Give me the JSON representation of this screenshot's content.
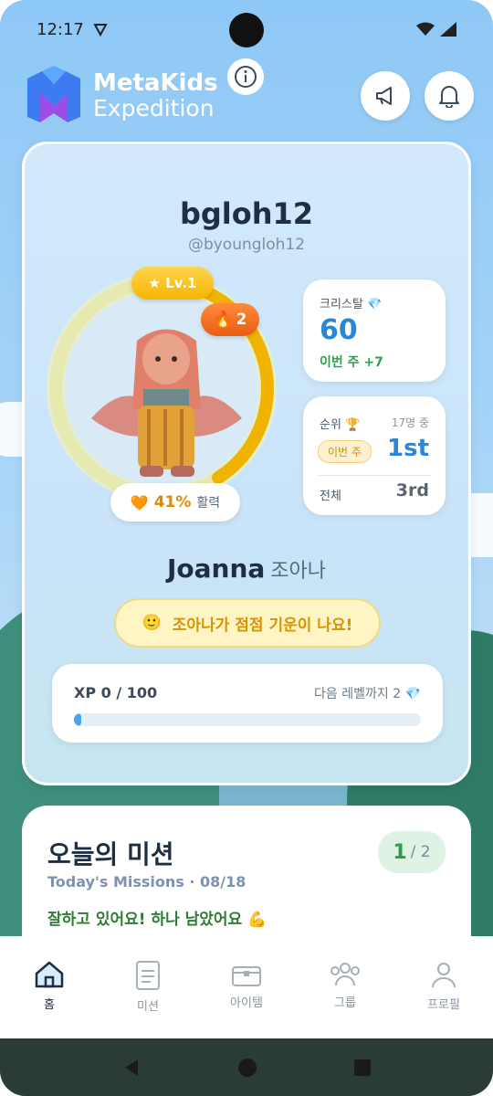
{
  "status_bar": {
    "time": "12:17"
  },
  "header": {
    "brand_line1": "MetaKids",
    "brand_line2": "Expedition",
    "info_icon": "info-icon",
    "announce_icon": "megaphone-icon",
    "bell_icon": "bell-icon"
  },
  "profile": {
    "username": "bgloh12",
    "handle": "@byoungloh12",
    "level_badge": "★ Lv.1",
    "streak": "2",
    "vitality_percent": "41%",
    "vitality_label": "활력",
    "vitality_fraction": 0.41
  },
  "crystal": {
    "label": "크리스탈 💎",
    "value": "60",
    "weekly": "이번 주 +7"
  },
  "ranking": {
    "label": "순위 🏆",
    "of_total": "17명 중",
    "week_pill": "이번 주",
    "week_rank": "1st",
    "all_label": "전체",
    "all_rank": "3rd"
  },
  "character": {
    "name_en": "Joanna",
    "name_ko": "조아나",
    "mood_emoji": "🙂",
    "mood_text": "조아나가 점점 기운이 나요!"
  },
  "xp": {
    "label": "XP 0 / 100",
    "next_level": "다음 레벨까지 2 💎",
    "progress": 0.0
  },
  "missions": {
    "title": "오늘의 미션",
    "subtitle": "Today's Missions · 08/18",
    "message": "잘하고 있어요! 하나 남았어요 💪",
    "done": "1",
    "total": "/ 2"
  },
  "nav": {
    "items": [
      {
        "label": "홈",
        "icon": "home-icon"
      },
      {
        "label": "미션",
        "icon": "mission-icon"
      },
      {
        "label": "아이템",
        "icon": "chest-icon"
      },
      {
        "label": "그룹",
        "icon": "group-icon"
      },
      {
        "label": "프로필",
        "icon": "profile-icon"
      }
    ]
  },
  "colors": {
    "accent_blue": "#2a86d6",
    "accent_gold": "#f5b400",
    "accent_green": "#2e9d4e"
  }
}
